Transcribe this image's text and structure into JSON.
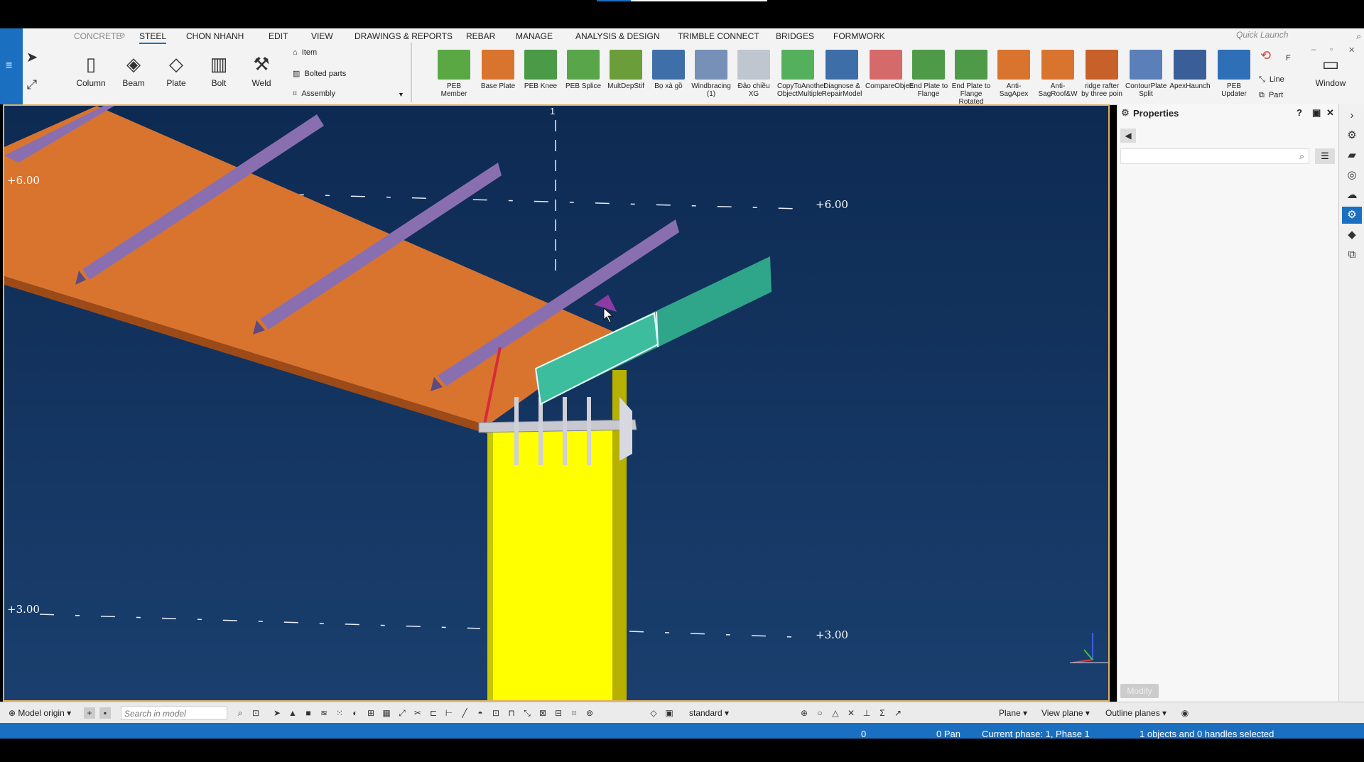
{
  "ribbon": {
    "tabs": [
      {
        "label": "CONCRETE",
        "active": false,
        "dim": true
      },
      {
        "label": "STEEL",
        "active": true
      },
      {
        "label": "CHON NHANH",
        "active": false
      },
      {
        "label": "EDIT",
        "active": false
      },
      {
        "label": "VIEW",
        "active": false
      },
      {
        "label": "DRAWINGS & REPORTS",
        "active": false
      },
      {
        "label": "REBAR",
        "active": false
      },
      {
        "label": "MANAGE",
        "active": false
      },
      {
        "label": "ANALYSIS & DESIGN",
        "active": false
      },
      {
        "label": "TRIMBLE CONNECT",
        "active": false
      },
      {
        "label": "BRIDGES",
        "active": false
      },
      {
        "label": "FORMWORK",
        "active": false
      }
    ],
    "quick_launch_placeholder": "Quick Launch",
    "tools": {
      "column": "Column",
      "beam": "Beam",
      "plate": "Plate",
      "bolt": "Bolt",
      "weld": "Weld",
      "item": "Item",
      "bolted_parts": "Bolted parts",
      "assembly": "Assembly"
    },
    "peb_tools": [
      {
        "label": "PEB Member",
        "color": "#5aa843"
      },
      {
        "label": "Base Plate",
        "color": "#d9742f"
      },
      {
        "label": "PEB Knee",
        "color": "#4a9a48"
      },
      {
        "label": "PEB Splice",
        "color": "#59a54a"
      },
      {
        "label": "MultDepStif",
        "color": "#6b9d3a"
      },
      {
        "label": "Bọ xà gồ",
        "color": "#3f6fa8"
      },
      {
        "label": "Windbracing (1)",
        "color": "#7690b8"
      },
      {
        "label": "Đảo chiều XG",
        "color": "#bfc6cf"
      },
      {
        "label": "CopyToAnother ObjectMultiple",
        "color": "#55b05e"
      },
      {
        "label": "Diagnose & RepairModel",
        "color": "#3e6ea8"
      },
      {
        "label": "CompareObjec",
        "color": "#d46a6a"
      },
      {
        "label": "End Plate to Flange",
        "color": "#4f9a48"
      },
      {
        "label": "End Plate to Flange Rotated",
        "color": "#4f9a48"
      },
      {
        "label": "Anti-SagApex",
        "color": "#d9742f"
      },
      {
        "label": "Anti-SagRoof&W",
        "color": "#d9742f"
      },
      {
        "label": "ridge rafter by three poin",
        "color": "#c8602a"
      },
      {
        "label": "ContourPlate Split",
        "color": "#5b7fb8"
      },
      {
        "label": "ApexHaunch",
        "color": "#3a5e98"
      },
      {
        "label": "PEB Updater",
        "color": "#2f6fb8"
      }
    ],
    "right_tools": {
      "line": "Line",
      "part": "Part",
      "f": "F",
      "window": "Window"
    }
  },
  "viewport": {
    "grid_label": "1",
    "levels": {
      "top_left": "+6.00",
      "top_right": "+6.00",
      "bottom_left": "+3.00",
      "bottom_right": "+3.00"
    }
  },
  "properties_panel": {
    "title": "Properties",
    "modify_label": "Modify"
  },
  "bottom_toolbar": {
    "origin": "Model origin",
    "search_placeholder": "Search in model",
    "standard": "standard",
    "plane": "Plane",
    "view_plane": "View plane",
    "outline_planes": "Outline planes"
  },
  "status": {
    "zero": "0",
    "pan": "0  Pan",
    "phase": "Current phase: 1, Phase 1",
    "selection": "1 objects and 0 handles selected"
  },
  "colors": {
    "accent": "#1a6fc0",
    "rafter": "#d9742f",
    "purlin": "#8a6fb0",
    "column": "#ffff00",
    "selected_member": "#2fa58a"
  }
}
